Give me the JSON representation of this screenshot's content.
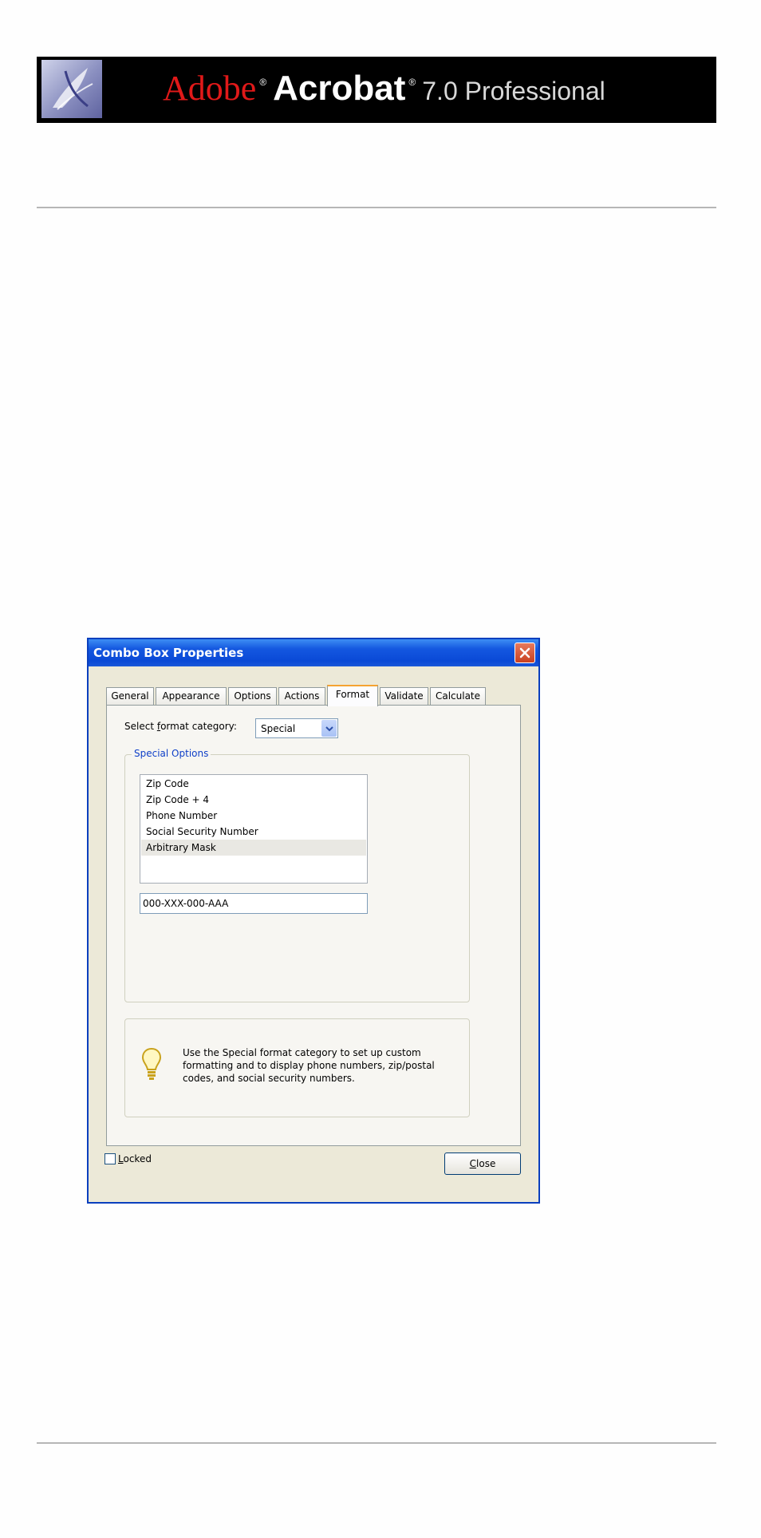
{
  "banner": {
    "brand_adobe": "Adobe",
    "brand_product": "Acrobat",
    "registered_mark": "®",
    "edition": "7.0 Professional",
    "logo_icon": "acrobat-feather-logo-icon",
    "adobe_color": "#e01919",
    "background_color": "#000000"
  },
  "dialog": {
    "title": "Combo Box Properties",
    "close_icon": "close-x-icon",
    "tabs": [
      {
        "label": "General"
      },
      {
        "label": "Appearance"
      },
      {
        "label": "Options"
      },
      {
        "label": "Actions"
      },
      {
        "label": "Format",
        "active": true
      },
      {
        "label": "Validate"
      },
      {
        "label": "Calculate"
      }
    ],
    "format_category": {
      "label_pre": "Select ",
      "label_key": "f",
      "label_post": "ormat category:",
      "value": "Special"
    },
    "special_options": {
      "legend": "Special Options",
      "items": [
        {
          "label": "Zip Code"
        },
        {
          "label": "Zip Code + 4"
        },
        {
          "label": "Phone Number"
        },
        {
          "label": "Social Security Number"
        },
        {
          "label": "Arbitrary Mask",
          "selected": true
        }
      ],
      "mask_value": "000-XXX-000-AAA"
    },
    "tip": {
      "icon": "lightbulb-icon",
      "text": "Use the Special format category to set up custom formatting and to display phone numbers, zip/postal codes, and social security numbers."
    },
    "locked": {
      "label_key": "L",
      "label_post": "ocked",
      "checked": false
    },
    "close_button": {
      "label_key": "C",
      "label_post": "lose"
    },
    "title_color": "#0a49d6",
    "active_tab_accent": "#f5a332"
  }
}
